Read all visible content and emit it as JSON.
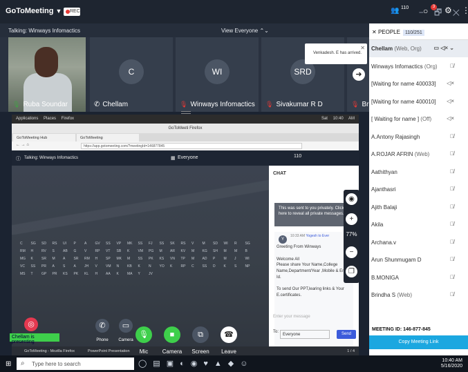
{
  "app": {
    "name": "GoToMeeting",
    "rec": "REC",
    "window_controls": "− 🗗 ✕"
  },
  "talk": {
    "label": "Talking: Winways Infomactics",
    "view": "View Everyone ⌃⌄",
    "people_icon_count": "110",
    "notif_badge": "3"
  },
  "tiles": [
    {
      "name": "Ruba Soundar"
    },
    {
      "name": "Chellam",
      "initial": "C"
    },
    {
      "name": "Winways Infomactics",
      "initial": "WI"
    },
    {
      "name": "Sivakumar R D",
      "initial": "SRD"
    },
    {
      "name": "Brin"
    }
  ],
  "toast": {
    "text": "Venkadesh. E has arrived."
  },
  "firefox": {
    "ubuntu_menu": "Applications  Places  Firefox",
    "clock": "Sat 10:40 AM",
    "title": "GoToMeeti Firefox",
    "tab1": "GoToMeeting Hub",
    "tab2": "GoToMeeting",
    "url": "https://app.gotomeeting.com/?meetingId=146877845",
    "gtm_talk": "Talking: Winways Infomactics",
    "gtm_view": "Everyone",
    "gtm_count": "110"
  },
  "grid": [
    "C",
    "SG",
    "SD",
    "RS",
    "UI",
    "P",
    "A",
    "GV",
    "SS",
    "VP",
    "MK",
    "SS",
    "FJ",
    "SS",
    "SK",
    "RS",
    "V",
    "M",
    "SD",
    "WI",
    "R",
    "SG",
    "RM",
    "H",
    "RV",
    "S",
    "AB",
    "G",
    "V",
    "RP",
    "VT",
    "SB",
    "K",
    "VM",
    "PG",
    "M",
    "AR",
    "KV",
    "M",
    "KG",
    "SH",
    "M",
    "M",
    "B",
    "MG",
    "K",
    "SR",
    "M",
    "A",
    "SR",
    "RM",
    "H",
    "SP",
    "MK",
    "M",
    "SS",
    "PK",
    "KS",
    "VN",
    "TP",
    "M",
    "AD",
    "P",
    "M",
    "J",
    "WI",
    "VC",
    "SS",
    "PR",
    "A",
    "S",
    "A",
    "JH",
    "V",
    "VM",
    "N",
    "KB",
    "K",
    "N",
    "YO",
    "K",
    "RP",
    "C",
    "SS",
    "D",
    "K",
    "S",
    "NP",
    "MS",
    "T",
    "GP",
    "PR",
    "KS",
    "PK",
    "KL",
    "H",
    "AA",
    "K",
    "MA",
    "Y",
    "JV"
  ],
  "chat": {
    "title": "CHAT",
    "private_note": "This was sent to you privately. Click here to reveal all private messages.",
    "time": "10:33 AM",
    "sender": "Yogesh to Ever",
    "body": "Greeting From Winways\n\nWelcome All\nPlease share Your Name,College Name,Department/Year ,Mobile & Email Id.\n\nTo send Our PPT,learing links & Your E.certificates.",
    "placeholder": "Enter your message",
    "to_label": "To:",
    "to_value": "Everyone",
    "send": "Send"
  },
  "zoom": {
    "percent": "77%"
  },
  "taskbar_inner": {
    "item1": "GoToMeeting - Mozilla Firefox",
    "item2": "PowerPoint Presentation",
    "page": "1 / 4"
  },
  "controls": {
    "mic": "Mic",
    "camera": "Camera",
    "screen": "Screen",
    "leave": "Leave",
    "phone": "Phone",
    "camera_small": "Camera",
    "share": "Share"
  },
  "presenting": "Chellam is presenting",
  "people": {
    "title": "PEOPLE",
    "count": "110/251",
    "list": [
      {
        "name": "Chellam",
        "tag": "(Web, Org)",
        "status": "▭ ◁× ⌄"
      },
      {
        "name": "Winways Infomactics",
        "tag": "(Org)",
        "status": "🎙̸"
      },
      {
        "name": "[Waiting for name 400033]",
        "tag": "",
        "status": "◁×"
      },
      {
        "name": "[Waiting for name 400010]",
        "tag": "",
        "status": "◁×"
      },
      {
        "name": "[ Waiting for name ]",
        "tag": "(Off)",
        "status": "◁×"
      },
      {
        "name": "A.Antony Rajasingh",
        "tag": "",
        "status": "🎙̸"
      },
      {
        "name": "A.ROJAR AFRIN",
        "tag": "(Web)",
        "status": "🎙̸"
      },
      {
        "name": "Aathithyan",
        "tag": "",
        "status": "🎙̸"
      },
      {
        "name": "Ajanthasri",
        "tag": "",
        "status": "🎙̸"
      },
      {
        "name": "Ajith Balaji",
        "tag": "",
        "status": "🎙̸"
      },
      {
        "name": "Akila",
        "tag": "",
        "status": "🎙̸"
      },
      {
        "name": "Archana.v",
        "tag": "",
        "status": "🎙̸"
      },
      {
        "name": "Arun Shunmugam D",
        "tag": "",
        "status": "🎙̸"
      },
      {
        "name": "B.MONIGA",
        "tag": "",
        "status": "🎙̸"
      },
      {
        "name": "Brindha S",
        "tag": "(Web)",
        "status": "🎙̸"
      }
    ],
    "meeting_id": "MEETING ID:  146-877-845",
    "copy": "Copy Meeting Link"
  },
  "windows": {
    "search": "Type here to search",
    "time": "10:40 AM",
    "date": "5/16/2020"
  },
  "colors": {
    "accent": "#1ba7e0",
    "rec": "#e53935",
    "presenting": "#3ecf4b"
  }
}
